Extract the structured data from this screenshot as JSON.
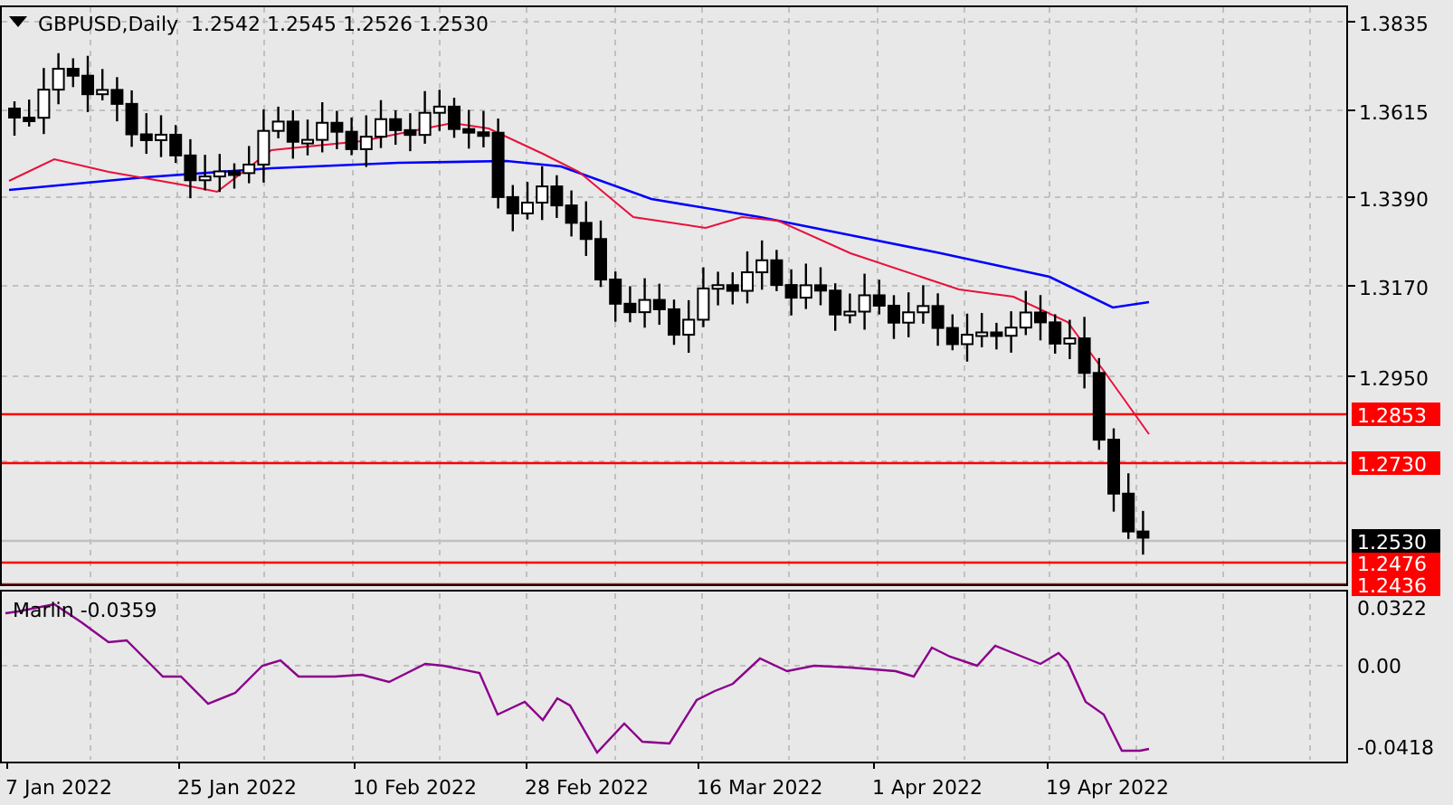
{
  "chart": {
    "symbol": "GBPUSD,Daily",
    "ohlc": [
      "1.2542",
      "1.2545",
      "1.2526",
      "1.2530"
    ],
    "price_ticks": [
      "1.3835",
      "1.3615",
      "1.3390",
      "1.3170",
      "1.2950"
    ],
    "level_labels": [
      {
        "text": "1.2853",
        "kind": "level"
      },
      {
        "text": "1.2730",
        "kind": "level"
      },
      {
        "text": "1.2530",
        "kind": "current"
      },
      {
        "text": "1.2476",
        "kind": "level"
      },
      {
        "text": "1.2436",
        "kind": "level"
      }
    ],
    "indicator": {
      "label": "Marlin -0.0359",
      "ticks": [
        "0.0322",
        "0.00",
        "-0.0418"
      ]
    },
    "date_labels": [
      "7 Jan 2022",
      "25 Jan 2022",
      "10 Feb 2022",
      "28 Feb 2022",
      "16 Mar 2022",
      "1 Apr 2022",
      "19 Apr 2022"
    ]
  }
}
